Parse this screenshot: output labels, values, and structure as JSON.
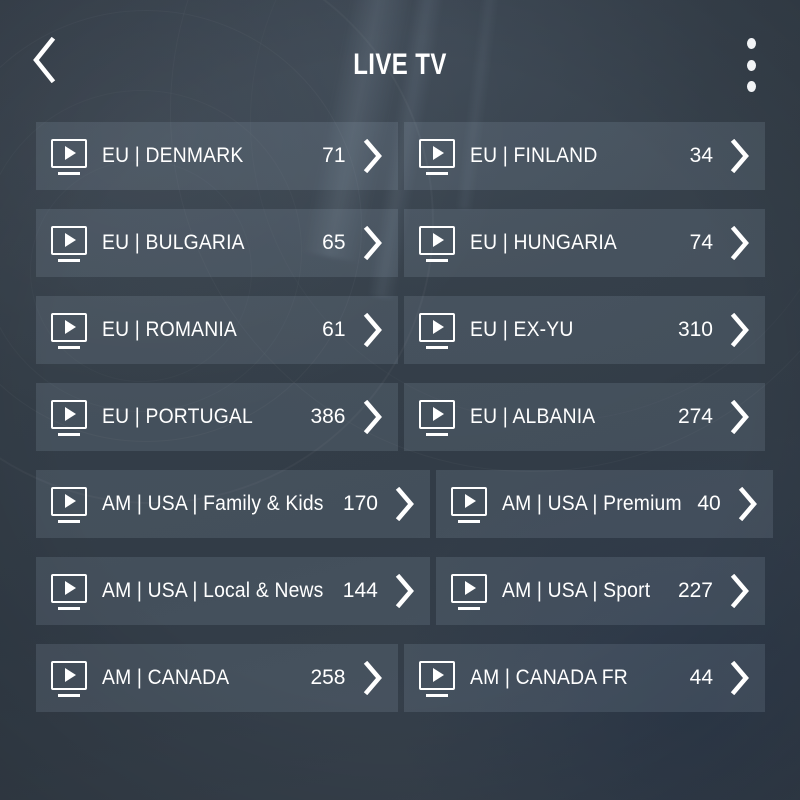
{
  "header": {
    "title": "LIVE TV",
    "back_icon": "chevron-left-icon",
    "menu_icon": "overflow-menu-icon"
  },
  "list": {
    "item_icon": "tv-play-icon",
    "arrow_icon": "chevron-right-icon",
    "rows": [
      [
        {
          "label": "EU | DENMARK",
          "count": "71"
        },
        {
          "label": "EU | FINLAND",
          "count": "34"
        }
      ],
      [
        {
          "label": "EU | BULGARIA",
          "count": "65"
        },
        {
          "label": "EU | HUNGARIA",
          "count": "74"
        }
      ],
      [
        {
          "label": "EU | ROMANIA",
          "count": "61"
        },
        {
          "label": "EU | EX-YU",
          "count": "310"
        }
      ],
      [
        {
          "label": "EU | PORTUGAL",
          "count": "386"
        },
        {
          "label": "EU | ALBANIA",
          "count": "274"
        }
      ],
      [
        {
          "label": "AM | USA | Family & Kids",
          "count": "170"
        },
        {
          "label": "AM | USA | Premium",
          "count": "40"
        }
      ],
      [
        {
          "label": "AM | USA | Local & News",
          "count": "144"
        },
        {
          "label": "AM | USA | Sport",
          "count": "227"
        }
      ],
      [
        {
          "label": "AM | CANADA",
          "count": "258"
        },
        {
          "label": "AM | CANADA FR",
          "count": "44"
        }
      ]
    ]
  },
  "colors": {
    "background": "#39434d",
    "tile": "rgba(160,178,196,0.16)",
    "text": "#ffffff"
  }
}
